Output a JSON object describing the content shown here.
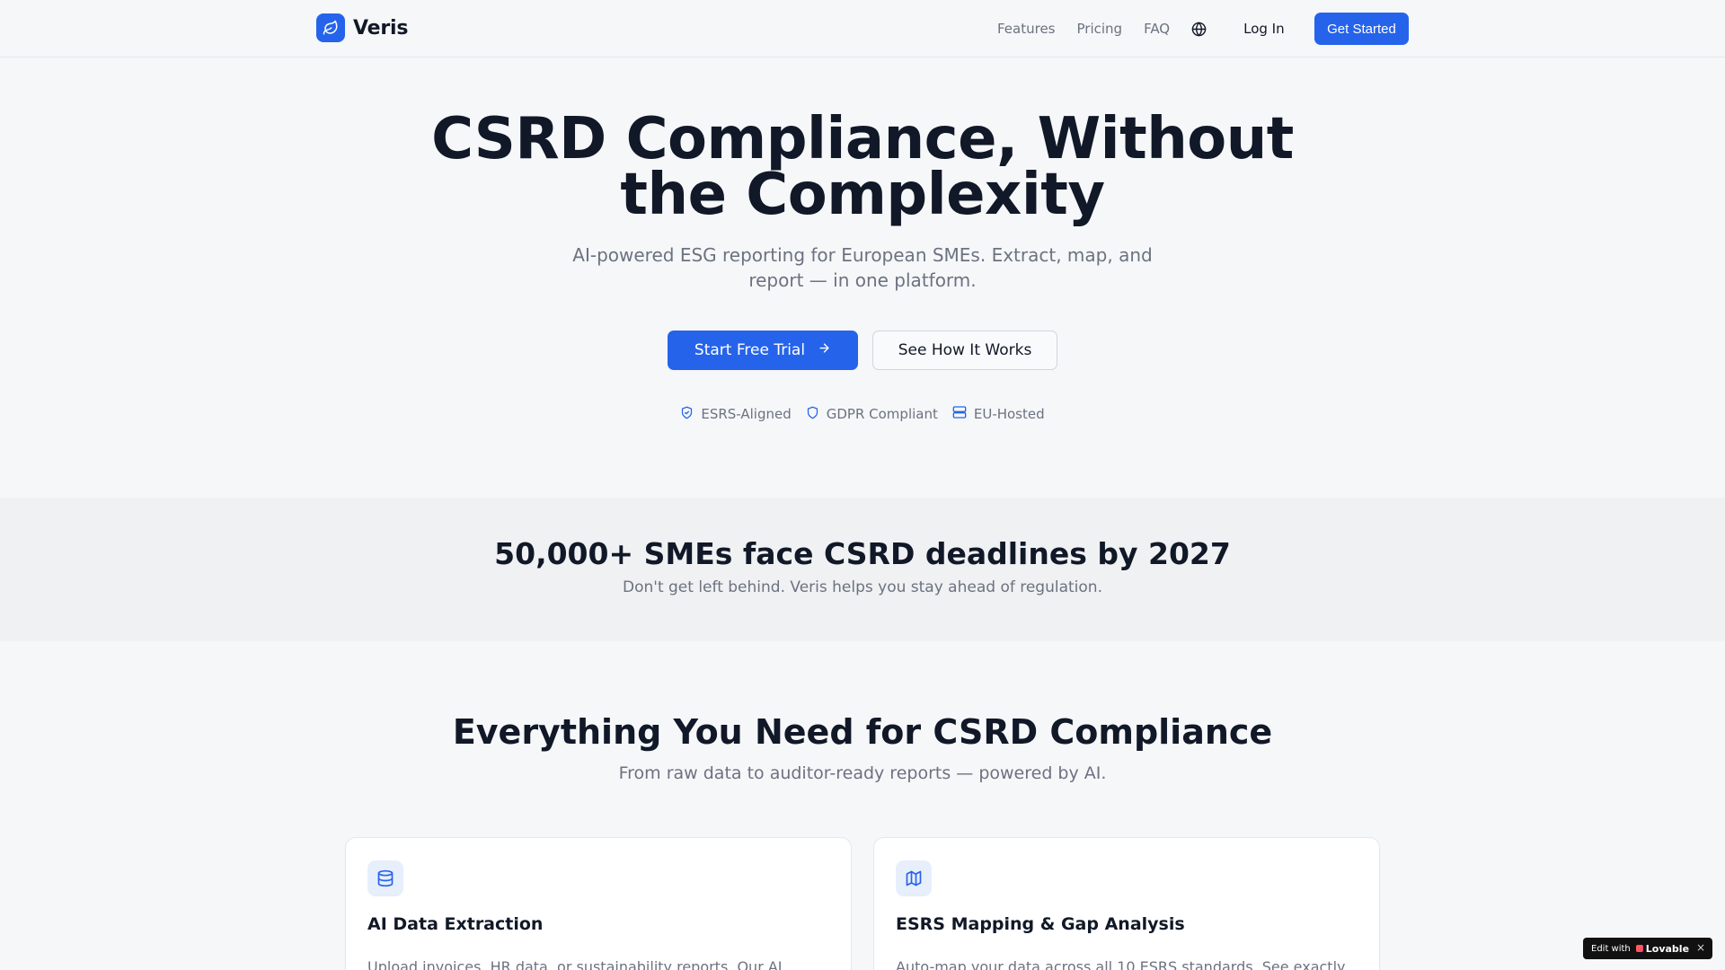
{
  "nav": {
    "brand": "Veris",
    "links": [
      "Features",
      "Pricing",
      "FAQ"
    ],
    "login": "Log In",
    "cta": "Get Started"
  },
  "hero": {
    "title_line1": "CSRD Compliance, Without",
    "title_line2": "the Complexity",
    "subtitle": "AI-powered ESG reporting for European SMEs. Extract, map, and report — in one platform.",
    "primary_cta": "Start Free Trial",
    "secondary_cta": "See How It Works",
    "badges": [
      "ESRS-Aligned",
      "GDPR Compliant",
      "EU-Hosted"
    ]
  },
  "band": {
    "title": "50,000+ SMEs face CSRD deadlines by 2027",
    "subtitle": "Don't get left behind. Veris helps you stay ahead of regulation."
  },
  "features": {
    "title": "Everything You Need for CSRD Compliance",
    "subtitle": "From raw data to auditor-ready reports — powered by AI.",
    "cards": [
      {
        "icon": "database-icon",
        "title": "AI Data Extraction",
        "text": "Upload invoices, HR data, or sustainability reports. Our AI"
      },
      {
        "icon": "map-icon",
        "title": "ESRS Mapping & Gap Analysis",
        "text": "Auto-map your data across all 10 ESRS standards. See exactly"
      }
    ]
  },
  "edit_badge": {
    "label": "Edit with",
    "brand": "Lovable",
    "close": "×"
  },
  "colors": {
    "accent": "#2563eb",
    "text": "#111827",
    "muted": "#6b7280",
    "background": "#f6f7f9"
  }
}
